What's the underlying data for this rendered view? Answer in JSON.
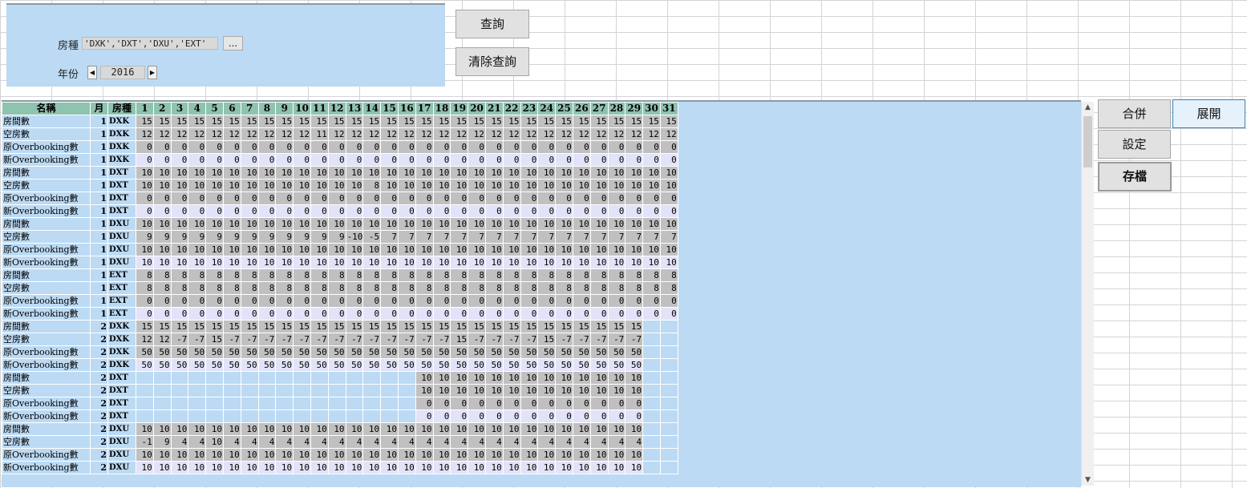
{
  "filters": {
    "roomtype_label": "房種",
    "roomtype_value": "'DXK','DXT','DXU','EXT'",
    "ellipsis_label": "...",
    "year_label": "年份",
    "year_value": "2016",
    "spin_left": "◀",
    "spin_right": "▶"
  },
  "buttons": {
    "query": "查詢",
    "clear_query": "清除查詢",
    "merge": "合併",
    "expand": "展開",
    "settings": "設定",
    "save": "存檔"
  },
  "table": {
    "headers": [
      "名稱",
      "月",
      "房種",
      "1",
      "2",
      "3",
      "4",
      "5",
      "6",
      "7",
      "8",
      "9",
      "10",
      "11",
      "12",
      "13",
      "14",
      "15",
      "16",
      "17",
      "18",
      "19",
      "20",
      "21",
      "22",
      "23",
      "24",
      "25",
      "26",
      "27",
      "28",
      "29",
      "30",
      "31"
    ],
    "rows": [
      {
        "name": "房間數",
        "month": "1",
        "type": "DXK",
        "values": [
          "15",
          "15",
          "15",
          "15",
          "15",
          "15",
          "15",
          "15",
          "15",
          "15",
          "15",
          "15",
          "15",
          "15",
          "15",
          "15",
          "15",
          "15",
          "15",
          "15",
          "15",
          "15",
          "15",
          "15",
          "15",
          "15",
          "15",
          "15",
          "15",
          "15",
          "15"
        ]
      },
      {
        "name": "空房數",
        "month": "1",
        "type": "DXK",
        "values": [
          "12",
          "12",
          "12",
          "12",
          "12",
          "12",
          "12",
          "12",
          "12",
          "12",
          "11",
          "12",
          "12",
          "12",
          "12",
          "12",
          "12",
          "12",
          "12",
          "12",
          "12",
          "12",
          "12",
          "12",
          "12",
          "12",
          "12",
          "12",
          "12",
          "12",
          "12"
        ]
      },
      {
        "name": "原Overbooking數",
        "month": "1",
        "type": "DXK",
        "values": [
          "0",
          "0",
          "0",
          "0",
          "0",
          "0",
          "0",
          "0",
          "0",
          "0",
          "0",
          "0",
          "0",
          "0",
          "0",
          "0",
          "0",
          "0",
          "0",
          "0",
          "0",
          "0",
          "0",
          "0",
          "0",
          "0",
          "0",
          "0",
          "0",
          "0",
          "0"
        ]
      },
      {
        "name": "新Overbooking數",
        "month": "1",
        "type": "DXK",
        "values": [
          "0",
          "0",
          "0",
          "0",
          "0",
          "0",
          "0",
          "0",
          "0",
          "0",
          "0",
          "0",
          "0",
          "0",
          "0",
          "0",
          "0",
          "0",
          "0",
          "0",
          "0",
          "0",
          "0",
          "0",
          "0",
          "0",
          "0",
          "0",
          "0",
          "0",
          "0"
        ]
      },
      {
        "name": "房間數",
        "month": "1",
        "type": "DXT",
        "values": [
          "10",
          "10",
          "10",
          "10",
          "10",
          "10",
          "10",
          "10",
          "10",
          "10",
          "10",
          "10",
          "10",
          "10",
          "10",
          "10",
          "10",
          "10",
          "10",
          "10",
          "10",
          "10",
          "10",
          "10",
          "10",
          "10",
          "10",
          "10",
          "10",
          "10",
          "10"
        ]
      },
      {
        "name": "空房數",
        "month": "1",
        "type": "DXT",
        "values": [
          "10",
          "10",
          "10",
          "10",
          "10",
          "10",
          "10",
          "10",
          "10",
          "10",
          "10",
          "10",
          "10",
          "8",
          "10",
          "10",
          "10",
          "10",
          "10",
          "10",
          "10",
          "10",
          "10",
          "10",
          "10",
          "10",
          "10",
          "10",
          "10",
          "10",
          "10"
        ]
      },
      {
        "name": "原Overbooking數",
        "month": "1",
        "type": "DXT",
        "values": [
          "0",
          "0",
          "0",
          "0",
          "0",
          "0",
          "0",
          "0",
          "0",
          "0",
          "0",
          "0",
          "0",
          "0",
          "0",
          "0",
          "0",
          "0",
          "0",
          "0",
          "0",
          "0",
          "0",
          "0",
          "0",
          "0",
          "0",
          "0",
          "0",
          "0",
          "0"
        ]
      },
      {
        "name": "新Overbooking數",
        "month": "1",
        "type": "DXT",
        "values": [
          "0",
          "0",
          "0",
          "0",
          "0",
          "0",
          "0",
          "0",
          "0",
          "0",
          "0",
          "0",
          "0",
          "0",
          "0",
          "0",
          "0",
          "0",
          "0",
          "0",
          "0",
          "0",
          "0",
          "0",
          "0",
          "0",
          "0",
          "0",
          "0",
          "0",
          "0"
        ]
      },
      {
        "name": "房間數",
        "month": "1",
        "type": "DXU",
        "values": [
          "10",
          "10",
          "10",
          "10",
          "10",
          "10",
          "10",
          "10",
          "10",
          "10",
          "10",
          "10",
          "10",
          "10",
          "10",
          "10",
          "10",
          "10",
          "10",
          "10",
          "10",
          "10",
          "10",
          "10",
          "10",
          "10",
          "10",
          "10",
          "10",
          "10",
          "10"
        ]
      },
      {
        "name": "空房數",
        "month": "1",
        "type": "DXU",
        "values": [
          "9",
          "9",
          "9",
          "9",
          "9",
          "9",
          "9",
          "9",
          "9",
          "9",
          "9",
          "9",
          "-10",
          "-5",
          "7",
          "7",
          "7",
          "7",
          "7",
          "7",
          "7",
          "7",
          "7",
          "7",
          "7",
          "7",
          "7",
          "7",
          "7",
          "7",
          "7"
        ]
      },
      {
        "name": "原Overbooking數",
        "month": "1",
        "type": "DXU",
        "values": [
          "10",
          "10",
          "10",
          "10",
          "10",
          "10",
          "10",
          "10",
          "10",
          "10",
          "10",
          "10",
          "10",
          "10",
          "10",
          "10",
          "10",
          "10",
          "10",
          "10",
          "10",
          "10",
          "10",
          "10",
          "10",
          "10",
          "10",
          "10",
          "10",
          "10",
          "10"
        ]
      },
      {
        "name": "新Overbooking數",
        "month": "1",
        "type": "DXU",
        "values": [
          "10",
          "10",
          "10",
          "10",
          "10",
          "10",
          "10",
          "10",
          "10",
          "10",
          "10",
          "10",
          "10",
          "10",
          "10",
          "10",
          "10",
          "10",
          "10",
          "10",
          "10",
          "10",
          "10",
          "10",
          "10",
          "10",
          "10",
          "10",
          "10",
          "10",
          "10"
        ]
      },
      {
        "name": "房間數",
        "month": "1",
        "type": "EXT",
        "values": [
          "8",
          "8",
          "8",
          "8",
          "8",
          "8",
          "8",
          "8",
          "8",
          "8",
          "8",
          "8",
          "8",
          "8",
          "8",
          "8",
          "8",
          "8",
          "8",
          "8",
          "8",
          "8",
          "8",
          "8",
          "8",
          "8",
          "8",
          "8",
          "8",
          "8",
          "8"
        ]
      },
      {
        "name": "空房數",
        "month": "1",
        "type": "EXT",
        "values": [
          "8",
          "8",
          "8",
          "8",
          "8",
          "8",
          "8",
          "8",
          "8",
          "8",
          "8",
          "8",
          "8",
          "8",
          "8",
          "8",
          "8",
          "8",
          "8",
          "8",
          "8",
          "8",
          "8",
          "8",
          "8",
          "8",
          "8",
          "8",
          "8",
          "8",
          "8"
        ]
      },
      {
        "name": "原Overbooking數",
        "month": "1",
        "type": "EXT",
        "values": [
          "0",
          "0",
          "0",
          "0",
          "0",
          "0",
          "0",
          "0",
          "0",
          "0",
          "0",
          "0",
          "0",
          "0",
          "0",
          "0",
          "0",
          "0",
          "0",
          "0",
          "0",
          "0",
          "0",
          "0",
          "0",
          "0",
          "0",
          "0",
          "0",
          "0",
          "0"
        ]
      },
      {
        "name": "新Overbooking數",
        "month": "1",
        "type": "EXT",
        "values": [
          "0",
          "0",
          "0",
          "0",
          "0",
          "0",
          "0",
          "0",
          "0",
          "0",
          "0",
          "0",
          "0",
          "0",
          "0",
          "0",
          "0",
          "0",
          "0",
          "0",
          "0",
          "0",
          "0",
          "0",
          "0",
          "0",
          "0",
          "0",
          "0",
          "0",
          "0"
        ]
      },
      {
        "name": "房間數",
        "month": "2",
        "type": "DXK",
        "values": [
          "15",
          "15",
          "15",
          "15",
          "15",
          "15",
          "15",
          "15",
          "15",
          "15",
          "15",
          "15",
          "15",
          "15",
          "15",
          "15",
          "15",
          "15",
          "15",
          "15",
          "15",
          "15",
          "15",
          "15",
          "15",
          "15",
          "15",
          "15",
          "15",
          "",
          ""
        ]
      },
      {
        "name": "空房數",
        "month": "2",
        "type": "DXK",
        "values": [
          "12",
          "12",
          "-7",
          "-7",
          "15",
          "-7",
          "-7",
          "-7",
          "-7",
          "-7",
          "-7",
          "-7",
          "-7",
          "-7",
          "-7",
          "-7",
          "-7",
          "-7",
          "15",
          "-7",
          "-7",
          "-7",
          "-7",
          "15",
          "-7",
          "-7",
          "-7",
          "-7",
          "-7",
          "",
          ""
        ]
      },
      {
        "name": "原Overbooking數",
        "month": "2",
        "type": "DXK",
        "values": [
          "50",
          "50",
          "50",
          "50",
          "50",
          "50",
          "50",
          "50",
          "50",
          "50",
          "50",
          "50",
          "50",
          "50",
          "50",
          "50",
          "50",
          "50",
          "50",
          "50",
          "50",
          "50",
          "50",
          "50",
          "50",
          "50",
          "50",
          "50",
          "50",
          "",
          ""
        ]
      },
      {
        "name": "新Overbooking數",
        "month": "2",
        "type": "DXK",
        "values": [
          "50",
          "50",
          "50",
          "50",
          "50",
          "50",
          "50",
          "50",
          "50",
          "50",
          "50",
          "50",
          "50",
          "50",
          "50",
          "50",
          "50",
          "50",
          "50",
          "50",
          "50",
          "50",
          "50",
          "50",
          "50",
          "50",
          "50",
          "50",
          "50",
          "",
          ""
        ]
      },
      {
        "name": "房間數",
        "month": "2",
        "type": "DXT",
        "values": [
          "",
          "",
          "",
          "",
          "",
          "",
          "",
          "",
          "",
          "",
          "",
          "",
          "",
          "",
          "",
          "",
          "10",
          "10",
          "10",
          "10",
          "10",
          "10",
          "10",
          "10",
          "10",
          "10",
          "10",
          "10",
          "10",
          "",
          ""
        ]
      },
      {
        "name": "空房數",
        "month": "2",
        "type": "DXT",
        "values": [
          "",
          "",
          "",
          "",
          "",
          "",
          "",
          "",
          "",
          "",
          "",
          "",
          "",
          "",
          "",
          "",
          "10",
          "10",
          "10",
          "10",
          "10",
          "10",
          "10",
          "10",
          "10",
          "10",
          "10",
          "10",
          "10",
          "",
          ""
        ]
      },
      {
        "name": "原Overbooking數",
        "month": "2",
        "type": "DXT",
        "values": [
          "",
          "",
          "",
          "",
          "",
          "",
          "",
          "",
          "",
          "",
          "",
          "",
          "",
          "",
          "",
          "",
          "0",
          "0",
          "0",
          "0",
          "0",
          "0",
          "0",
          "0",
          "0",
          "0",
          "0",
          "0",
          "0",
          "",
          ""
        ]
      },
      {
        "name": "新Overbooking數",
        "month": "2",
        "type": "DXT",
        "values": [
          "",
          "",
          "",
          "",
          "",
          "",
          "",
          "",
          "",
          "",
          "",
          "",
          "",
          "",
          "",
          "",
          "0",
          "0",
          "0",
          "0",
          "0",
          "0",
          "0",
          "0",
          "0",
          "0",
          "0",
          "0",
          "0",
          "",
          ""
        ]
      },
      {
        "name": "房間數",
        "month": "2",
        "type": "DXU",
        "values": [
          "10",
          "10",
          "10",
          "10",
          "10",
          "10",
          "10",
          "10",
          "10",
          "10",
          "10",
          "10",
          "10",
          "10",
          "10",
          "10",
          "10",
          "10",
          "10",
          "10",
          "10",
          "10",
          "10",
          "10",
          "10",
          "10",
          "10",
          "10",
          "10",
          "",
          ""
        ]
      },
      {
        "name": "空房數",
        "month": "2",
        "type": "DXU",
        "values": [
          "-1",
          "9",
          "4",
          "4",
          "10",
          "4",
          "4",
          "4",
          "4",
          "4",
          "4",
          "4",
          "4",
          "4",
          "4",
          "4",
          "4",
          "4",
          "4",
          "4",
          "4",
          "4",
          "4",
          "4",
          "4",
          "4",
          "4",
          "4",
          "4",
          "",
          ""
        ]
      },
      {
        "name": "原Overbooking數",
        "month": "2",
        "type": "DXU",
        "values": [
          "10",
          "10",
          "10",
          "10",
          "10",
          "10",
          "10",
          "10",
          "10",
          "10",
          "10",
          "10",
          "10",
          "10",
          "10",
          "10",
          "10",
          "10",
          "10",
          "10",
          "10",
          "10",
          "10",
          "10",
          "10",
          "10",
          "10",
          "10",
          "10",
          "",
          ""
        ]
      },
      {
        "name": "新Overbooking數",
        "month": "2",
        "type": "DXU",
        "values": [
          "10",
          "10",
          "10",
          "10",
          "10",
          "10",
          "10",
          "10",
          "10",
          "10",
          "10",
          "10",
          "10",
          "10",
          "10",
          "10",
          "10",
          "10",
          "10",
          "10",
          "10",
          "10",
          "10",
          "10",
          "10",
          "10",
          "10",
          "10",
          "10",
          "",
          ""
        ]
      }
    ]
  },
  "colors": {
    "panel_bg": "#bcdaf3",
    "header_bg": "#8ec3b0",
    "editable_cell": "#c0c0c0",
    "readonly_cell": "#e2e2f8"
  }
}
